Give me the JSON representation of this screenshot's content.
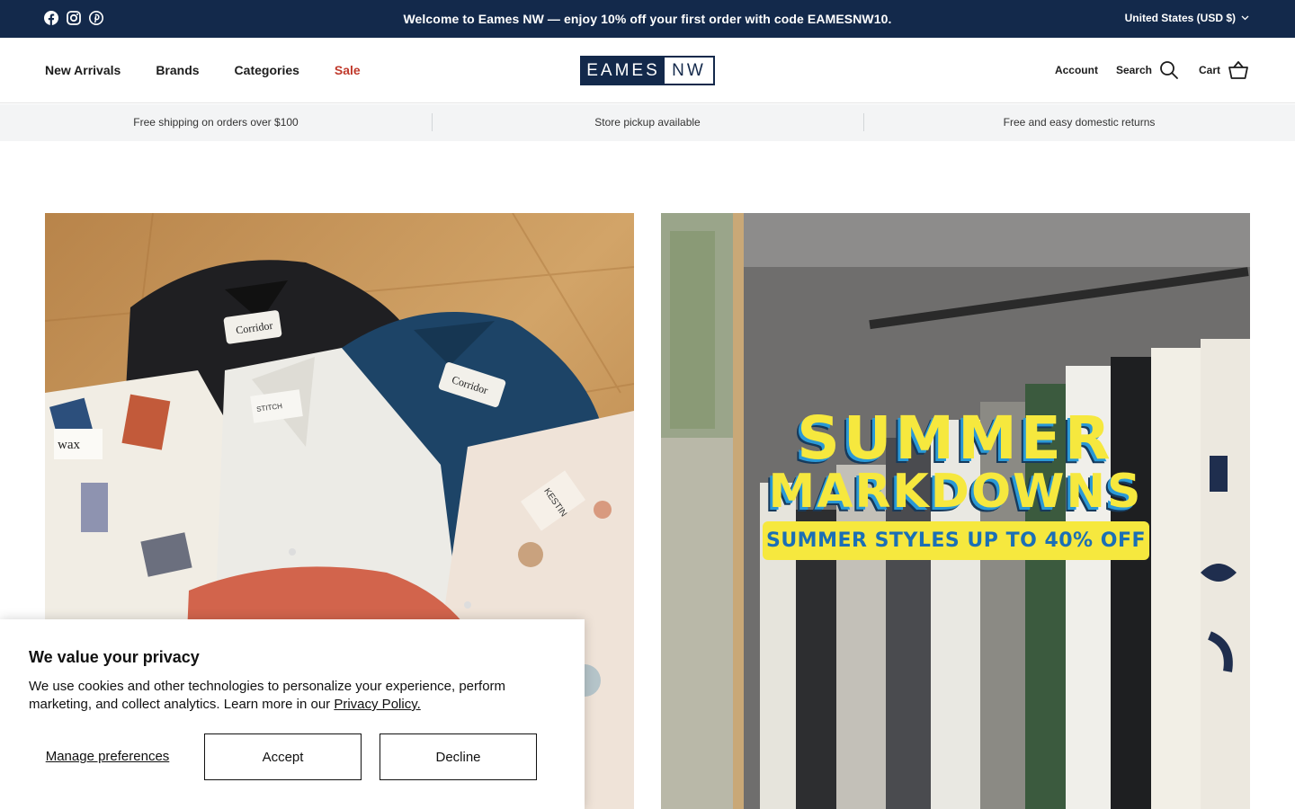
{
  "announcement": {
    "text": "Welcome to Eames NW — enjoy 10% off your first order with code EAMESNW10.",
    "currency": "United States (USD $)",
    "social_icons": [
      "facebook-icon",
      "instagram-icon",
      "pinterest-icon"
    ]
  },
  "header": {
    "nav": [
      {
        "label": "New Arrivals"
      },
      {
        "label": "Brands"
      },
      {
        "label": "Categories"
      },
      {
        "label": "Sale"
      }
    ],
    "logo": {
      "left": "EAMES",
      "right": "NW"
    },
    "account_label": "Account",
    "search_label": "Search",
    "cart_label": "Cart"
  },
  "features": [
    "Free shipping on orders over $100",
    "Store pickup available",
    "Free and easy domestic returns"
  ],
  "hero": {
    "promo_line1": "SUMMER",
    "promo_line2": "MARKDOWNS",
    "promo_line3": "SUMMER STYLES UP TO 40% OFF",
    "shirt_labels": [
      "Corridor",
      "Corridor",
      "wax",
      "STITCH",
      "KESTIN"
    ]
  },
  "cookie": {
    "title": "We value your privacy",
    "text": "We use cookies and other technologies to personalize your experience, perform marketing, and collect analytics. Learn more in our",
    "link": "Privacy Policy.",
    "manage": "Manage preferences",
    "accept": "Accept",
    "decline": "Decline"
  },
  "colors": {
    "brand_navy": "#13294b",
    "sale_red": "#c0392b",
    "promo_yellow": "#f6e83e",
    "promo_blue": "#2a99d6"
  }
}
